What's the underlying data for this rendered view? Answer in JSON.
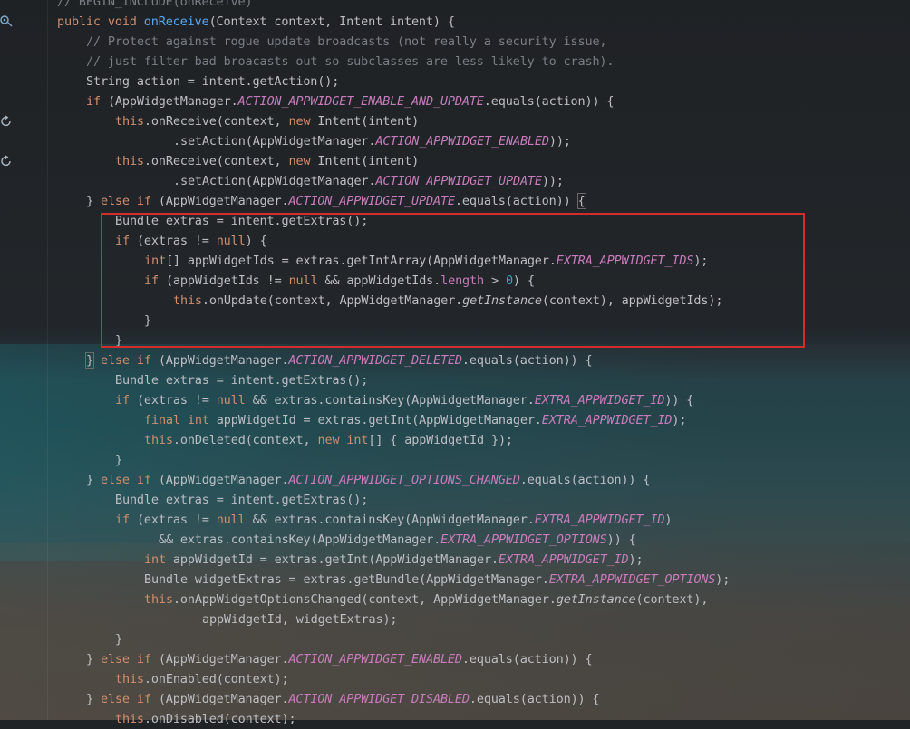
{
  "editor": {
    "language": "Java",
    "highlight_color": "#d42b2b",
    "gutter_icons": [
      "override-up-icon",
      "recursive-call-icon",
      "recursive-call-icon"
    ],
    "lines": [
      "// BEGIN_INCLUDE(onReceive)",
      "public void onReceive(Context context, Intent intent) {",
      "// Protect against rogue update broadcasts (not really a security issue,",
      "// just filter bad broacasts out so subclasses are less likely to crash).",
      "String action = intent.getAction();",
      "if (AppWidgetManager.ACTION_APPWIDGET_ENABLE_AND_UPDATE.equals(action)) {",
      "this.onReceive(context, new Intent(intent)",
      ".setAction(AppWidgetManager.ACTION_APPWIDGET_ENABLED));",
      "this.onReceive(context, new Intent(intent)",
      ".setAction(AppWidgetManager.ACTION_APPWIDGET_UPDATE));",
      "} else if (AppWidgetManager.ACTION_APPWIDGET_UPDATE.equals(action)) {",
      "Bundle extras = intent.getExtras();",
      "if (extras != null) {",
      "int[] appWidgetIds = extras.getIntArray(AppWidgetManager.EXTRA_APPWIDGET_IDS);",
      "if (appWidgetIds != null && appWidgetIds.length > 0) {",
      "this.onUpdate(context, AppWidgetManager.getInstance(context), appWidgetIds);",
      "}",
      "}",
      "} else if (AppWidgetManager.ACTION_APPWIDGET_DELETED.equals(action)) {",
      "Bundle extras = intent.getExtras();",
      "if (extras != null && extras.containsKey(AppWidgetManager.EXTRA_APPWIDGET_ID)) {",
      "final int appWidgetId = extras.getInt(AppWidgetManager.EXTRA_APPWIDGET_ID);",
      "this.onDeleted(context, new int[] { appWidgetId });",
      "}",
      "} else if (AppWidgetManager.ACTION_APPWIDGET_OPTIONS_CHANGED.equals(action)) {",
      "Bundle extras = intent.getExtras();",
      "if (extras != null && extras.containsKey(AppWidgetManager.EXTRA_APPWIDGET_ID)",
      "&& extras.containsKey(AppWidgetManager.EXTRA_APPWIDGET_OPTIONS)) {",
      "int appWidgetId = extras.getInt(AppWidgetManager.EXTRA_APPWIDGET_ID);",
      "Bundle widgetExtras = extras.getBundle(AppWidgetManager.EXTRA_APPWIDGET_OPTIONS);",
      "this.onAppWidgetOptionsChanged(context, AppWidgetManager.getInstance(context),",
      "appWidgetId, widgetExtras);",
      "}",
      "} else if (AppWidgetManager.ACTION_APPWIDGET_ENABLED.equals(action)) {",
      "this.onEnabled(context);",
      "} else if (AppWidgetManager.ACTION_APPWIDGET_DISABLED.equals(action)) {",
      "this.onDisabled(context);"
    ]
  }
}
